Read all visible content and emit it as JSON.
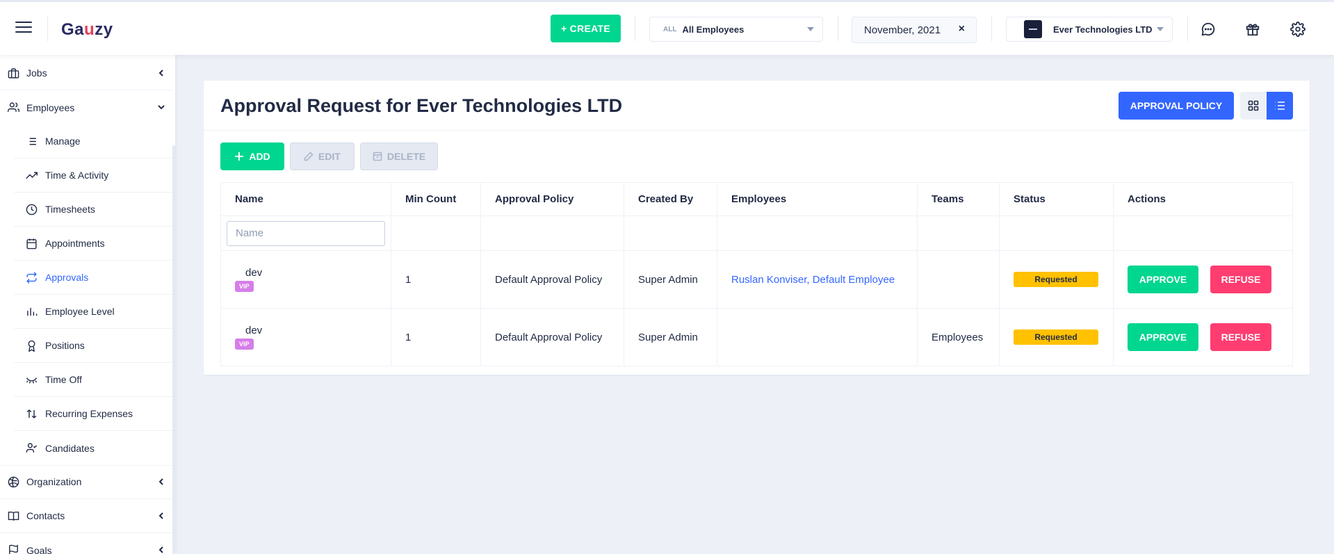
{
  "header": {
    "logo": "Gauzy",
    "create_label": "+ CREATE",
    "employee_filter": {
      "prefix": "ALL",
      "value": "All Employees"
    },
    "date_value": "November, 2021",
    "date_clear": "×",
    "organization": "Ever Technologies LTD"
  },
  "sidebar": {
    "top_items": [
      {
        "label": "Jobs",
        "icon": "briefcase-icon"
      },
      {
        "label": "Employees",
        "icon": "people-icon"
      },
      {
        "label": "Organization",
        "icon": "globe-icon"
      },
      {
        "label": "Contacts",
        "icon": "book-icon"
      },
      {
        "label": "Goals",
        "icon": "flag-icon"
      }
    ],
    "sub_items": [
      {
        "label": "Manage",
        "icon": "list-icon"
      },
      {
        "label": "Time & Activity",
        "icon": "trending-icon"
      },
      {
        "label": "Timesheets",
        "icon": "clock-icon"
      },
      {
        "label": "Appointments",
        "icon": "calendar-icon"
      },
      {
        "label": "Approvals",
        "icon": "repeat-icon",
        "active": true
      },
      {
        "label": "Employee Level",
        "icon": "bar-chart-icon"
      },
      {
        "label": "Positions",
        "icon": "award-icon"
      },
      {
        "label": "Time Off",
        "icon": "eye-off-icon"
      },
      {
        "label": "Recurring Expenses",
        "icon": "swap-icon"
      },
      {
        "label": "Candidates",
        "icon": "person-check-icon"
      }
    ]
  },
  "page": {
    "title": "Approval Request for Ever Technologies LTD",
    "policy_button": "APPROVAL POLICY",
    "toolbar": {
      "add": "ADD",
      "edit": "EDIT",
      "delete": "DELETE"
    }
  },
  "table": {
    "columns": [
      "Name",
      "Min Count",
      "Approval Policy",
      "Created By",
      "Employees",
      "Teams",
      "Status",
      "Actions"
    ],
    "name_filter_placeholder": "Name",
    "rows": [
      {
        "name": "dev",
        "tag": "VIP",
        "min_count": "1",
        "policy": "Default Approval Policy",
        "created_by": "Super Admin",
        "employees": "Ruslan Konviser, Default Employee",
        "teams": "",
        "status": "Requested",
        "approve": "APPROVE",
        "refuse": "REFUSE"
      },
      {
        "name": "dev",
        "tag": "VIP",
        "min_count": "1",
        "policy": "Default Approval Policy",
        "created_by": "Super Admin",
        "employees": "",
        "teams": "Employees",
        "status": "Requested",
        "approve": "APPROVE",
        "refuse": "REFUSE"
      }
    ]
  },
  "colors": {
    "primary": "#3366ff",
    "success": "#00d68f",
    "danger": "#ff3d71",
    "warning": "#ffc100",
    "vip": "#d67ee9"
  }
}
